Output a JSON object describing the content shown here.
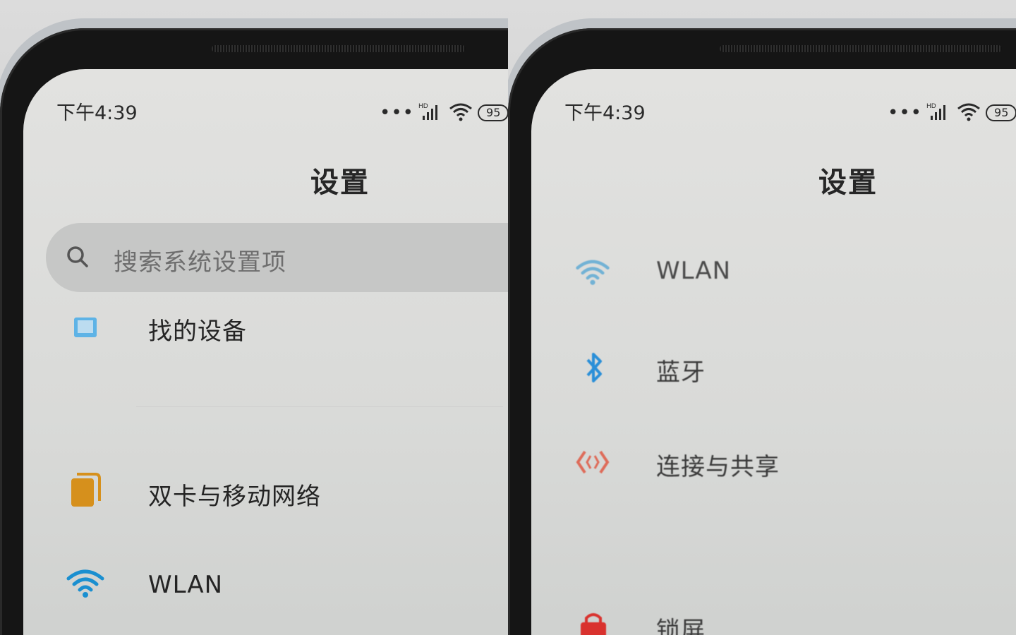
{
  "left_screen": {
    "status_bar": {
      "time": "下午4:39",
      "signal_label": "HD",
      "battery": "95"
    },
    "title": "设置",
    "search": {
      "placeholder": "搜索系统设置项"
    },
    "items": [
      {
        "label": "找的设备",
        "icon": "device-icon",
        "color": "#4aa3dc"
      },
      {
        "label": "双卡与移动网络",
        "icon": "sim-card-icon",
        "color": "#d6901c"
      },
      {
        "label": "WLAN",
        "icon": "wifi-icon",
        "color": "#1a8fd0"
      }
    ]
  },
  "right_screen": {
    "status_bar": {
      "time": "下午4:39",
      "signal_label": "HD",
      "battery": "95"
    },
    "title": "设置",
    "items": [
      {
        "label": "WLAN",
        "icon": "wifi-icon",
        "color": "#1a8fd0"
      },
      {
        "label": "蓝牙",
        "icon": "bluetooth-icon",
        "color": "#2a8fd8"
      },
      {
        "label": "连接与共享",
        "icon": "connection-sharing-icon",
        "color": "#e0503a"
      },
      {
        "label": "锁屏",
        "icon": "lock-screen-icon",
        "color": "#d9322e"
      }
    ]
  }
}
